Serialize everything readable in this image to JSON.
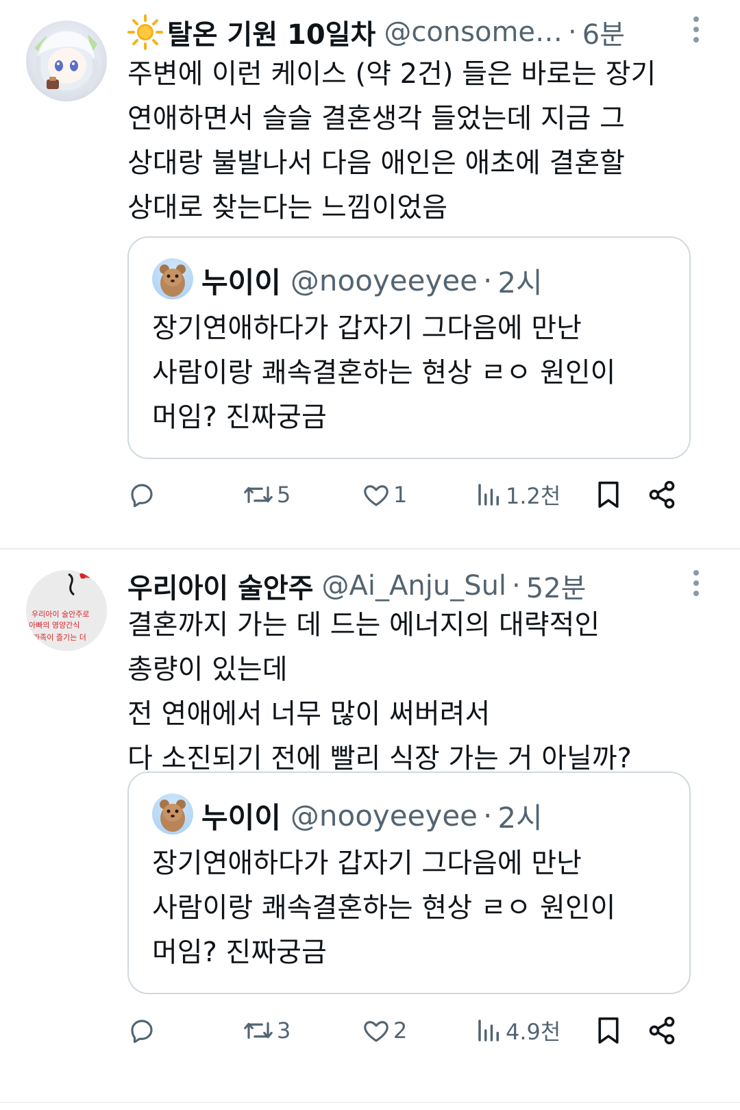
{
  "tweets": [
    {
      "display_name": "탈온 기원 10일차",
      "handle": "@consome…",
      "time": "6분",
      "text": "주변에 이런 케이스 (약 2건) 들은 바로는 장기\n연애하면서 슬슬 결혼생각 들었는데 지금 그\n상대랑 불발나서 다음 애인은 애초에 결혼할\n상대로 찾는다는 느낌이었음",
      "quote": {
        "display_name": "누이이",
        "handle": "@nooyeeyee",
        "time": "2시",
        "text": "장기연애하다가 갑자기 그다음에 만난\n사람이랑 쾌속결혼하는 현상 ㄹㅇ 원인이\n머임? 진짜궁금"
      },
      "actions": {
        "reply_count": "",
        "retweet_count": "5",
        "like_count": "1",
        "view_count": "1.2천"
      }
    },
    {
      "display_name": "우리아이 술안주",
      "handle": "@Ai_Anju_Sul",
      "time": "52분",
      "avatar_text": "우리아이 술안주로\n아빠의 영양간식\n가족이 즐기는 더",
      "text": "결혼까지 가는 데 드는 에너지의 대략적인\n총량이 있는데\n전 연애에서 너무 많이 써버려서\n다 소진되기 전에 빨리 식장 가는 거 아닐까?",
      "quote": {
        "display_name": "누이이",
        "handle": "@nooyeeyee",
        "time": "2시",
        "text": "장기연애하다가 갑자기 그다음에 만난\n사람이랑 쾌속결혼하는 현상 ㄹㅇ 원인이\n머임? 진짜궁금"
      },
      "actions": {
        "reply_count": "",
        "retweet_count": "3",
        "like_count": "2",
        "view_count": "4.9천"
      }
    }
  ],
  "separator": "·",
  "colors": {
    "text_primary": "#0f1419",
    "text_secondary": "#536471",
    "border": "#cfd9de",
    "sun_emoji": "#f5b21c"
  },
  "icons": {
    "name_emoji": "sun-icon",
    "reply": "reply-icon",
    "retweet": "retweet-icon",
    "like": "heart-icon",
    "views": "views-icon",
    "bookmark": "bookmark-icon",
    "share": "share-icon",
    "more": "more-icon"
  }
}
